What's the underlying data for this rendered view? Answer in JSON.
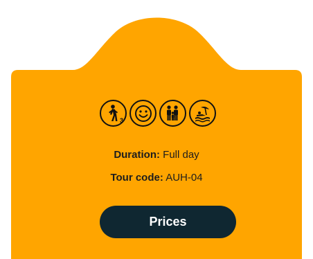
{
  "card": {
    "background": "#FFA500",
    "button_color": "#0F2731"
  },
  "icons": [
    "walking-difficulty-3-icon",
    "smiley-icon",
    "family-icon",
    "beach-icon"
  ],
  "difficulty_level": "3",
  "duration": {
    "label": "Duration:",
    "value": "Full day"
  },
  "tour_code": {
    "label": "Tour code:",
    "value": "AUH-04"
  },
  "prices_button": {
    "label": "Prices"
  }
}
